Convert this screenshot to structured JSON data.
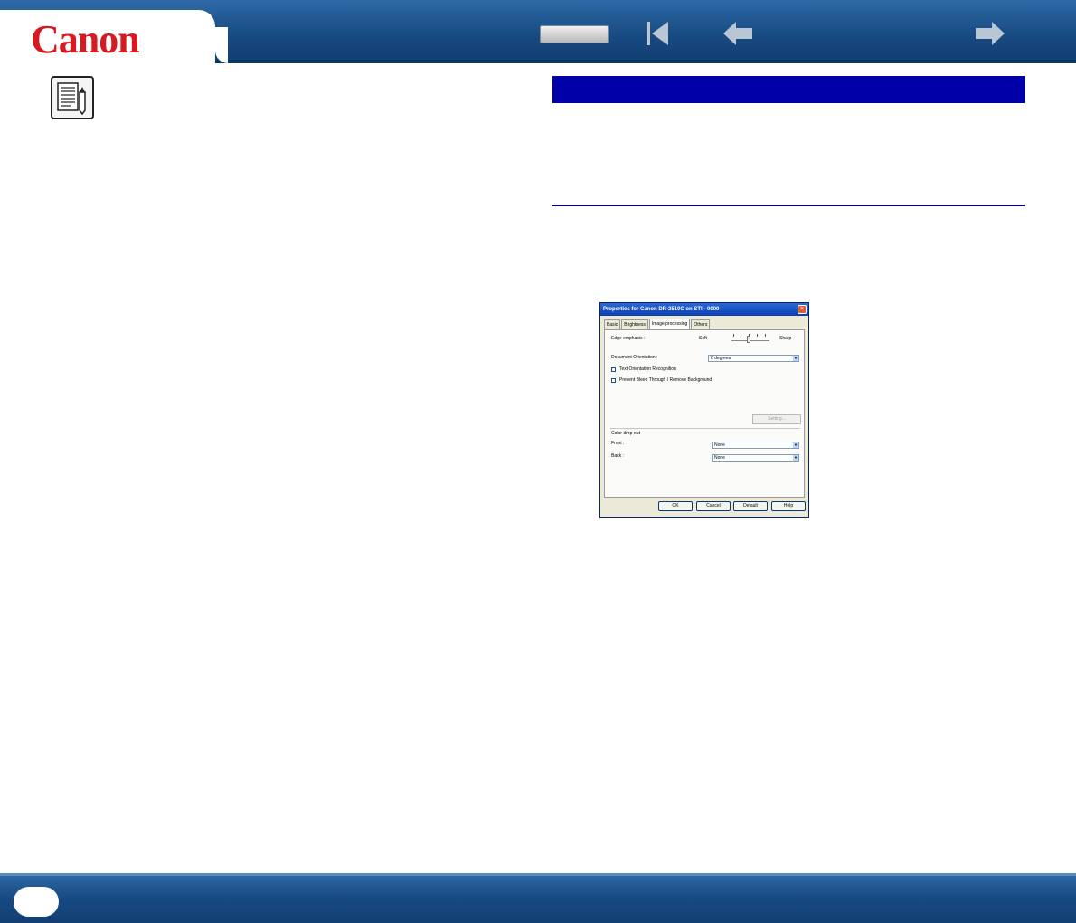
{
  "header": {
    "logo_text": "Canon",
    "nav": {
      "blank_button": "",
      "first_icon": "first-page-icon",
      "prev_icon": "previous-page-icon",
      "next_icon": "next-page-icon"
    }
  },
  "note_icon": "note-pencil-icon",
  "colors": {
    "header_blue": "#1d4f86",
    "section_bar": "#0000a8",
    "logo_red": "#d71920"
  },
  "dialog": {
    "title": "Properties for Canon DR-2510C on STI - 0000",
    "tabs": [
      "Basic",
      "Brightness",
      "Image processing",
      "Others"
    ],
    "active_tab": "Image processing",
    "edge_emphasis": {
      "label": "Edge emphasis :",
      "soft": "Soft",
      "sharp": "Sharp"
    },
    "document_orientation": {
      "label": "Document Orientation :",
      "value": "0 degrees"
    },
    "text_orientation_label": "Text Orientation Recognition",
    "prevent_bleed_label": "Prevent Bleed Through / Remove Background",
    "setting_button": "Setting...",
    "color_dropout": {
      "group_label": "Color drop-out",
      "front_label": "Front :",
      "front_value": "None",
      "back_label": "Back :",
      "back_value": "None"
    },
    "buttons": {
      "ok": "OK",
      "cancel": "Cancel",
      "default": "Default",
      "help": "Help"
    }
  },
  "footer": {
    "page_number": ""
  }
}
